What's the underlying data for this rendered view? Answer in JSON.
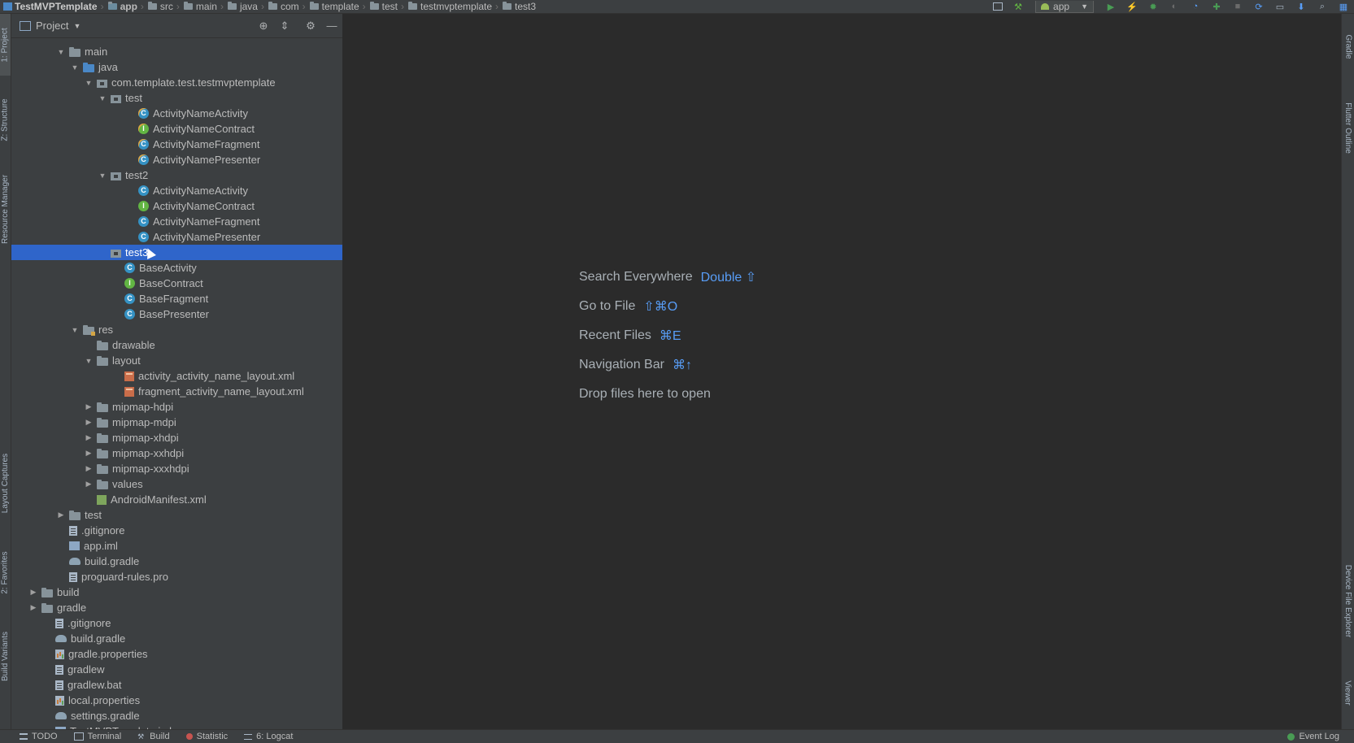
{
  "breadcrumbs": [
    "TestMVPTemplate",
    "app",
    "src",
    "main",
    "java",
    "com",
    "template",
    "test",
    "testmvptemplate",
    "test3"
  ],
  "run_config": {
    "label": "app"
  },
  "project_panel": {
    "title": "Project"
  },
  "tree": [
    {
      "label": "main",
      "indent": 3,
      "arrow": "open",
      "icon": "folder"
    },
    {
      "label": "java",
      "indent": 4,
      "arrow": "open",
      "icon": "folder-src"
    },
    {
      "label": "com.template.test.testmvptemplate",
      "indent": 5,
      "arrow": "open",
      "icon": "package"
    },
    {
      "label": "test",
      "indent": 6,
      "arrow": "open",
      "icon": "package"
    },
    {
      "label": "ActivityNameActivity",
      "indent": 8,
      "arrow": "none",
      "icon": "class-badge",
      "glyph": "C"
    },
    {
      "label": "ActivityNameContract",
      "indent": 8,
      "arrow": "none",
      "icon": "interface-badge",
      "glyph": "I"
    },
    {
      "label": "ActivityNameFragment",
      "indent": 8,
      "arrow": "none",
      "icon": "class-badge",
      "glyph": "C"
    },
    {
      "label": "ActivityNamePresenter",
      "indent": 8,
      "arrow": "none",
      "icon": "class-badge",
      "glyph": "C"
    },
    {
      "label": "test2",
      "indent": 6,
      "arrow": "open",
      "icon": "package"
    },
    {
      "label": "ActivityNameActivity",
      "indent": 8,
      "arrow": "none",
      "icon": "class",
      "glyph": "C"
    },
    {
      "label": "ActivityNameContract",
      "indent": 8,
      "arrow": "none",
      "icon": "interface",
      "glyph": "I"
    },
    {
      "label": "ActivityNameFragment",
      "indent": 8,
      "arrow": "none",
      "icon": "class",
      "glyph": "C"
    },
    {
      "label": "ActivityNamePresenter",
      "indent": 8,
      "arrow": "none",
      "icon": "class",
      "glyph": "C"
    },
    {
      "label": "test3",
      "indent": 6,
      "arrow": "none",
      "icon": "package",
      "selected": true
    },
    {
      "label": "BaseActivity",
      "indent": 7,
      "arrow": "none",
      "icon": "class",
      "glyph": "C"
    },
    {
      "label": "BaseContract",
      "indent": 7,
      "arrow": "none",
      "icon": "interface",
      "glyph": "I"
    },
    {
      "label": "BaseFragment",
      "indent": 7,
      "arrow": "none",
      "icon": "class",
      "glyph": "C"
    },
    {
      "label": "BasePresenter",
      "indent": 7,
      "arrow": "none",
      "icon": "class",
      "glyph": "C"
    },
    {
      "label": "res",
      "indent": 4,
      "arrow": "open",
      "icon": "folder-res"
    },
    {
      "label": "drawable",
      "indent": 5,
      "arrow": "none",
      "icon": "folder"
    },
    {
      "label": "layout",
      "indent": 5,
      "arrow": "open",
      "icon": "folder"
    },
    {
      "label": "activity_activity_name_layout.xml",
      "indent": 7,
      "arrow": "none",
      "icon": "xml"
    },
    {
      "label": "fragment_activity_name_layout.xml",
      "indent": 7,
      "arrow": "none",
      "icon": "xml"
    },
    {
      "label": "mipmap-hdpi",
      "indent": 5,
      "arrow": "closed",
      "icon": "folder"
    },
    {
      "label": "mipmap-mdpi",
      "indent": 5,
      "arrow": "closed",
      "icon": "folder"
    },
    {
      "label": "mipmap-xhdpi",
      "indent": 5,
      "arrow": "closed",
      "icon": "folder"
    },
    {
      "label": "mipmap-xxhdpi",
      "indent": 5,
      "arrow": "closed",
      "icon": "folder"
    },
    {
      "label": "mipmap-xxxhdpi",
      "indent": 5,
      "arrow": "closed",
      "icon": "folder"
    },
    {
      "label": "values",
      "indent": 5,
      "arrow": "closed",
      "icon": "folder"
    },
    {
      "label": "AndroidManifest.xml",
      "indent": 5,
      "arrow": "none",
      "icon": "manifest"
    },
    {
      "label": "test",
      "indent": 3,
      "arrow": "closed",
      "icon": "folder"
    },
    {
      "label": ".gitignore",
      "indent": 3,
      "arrow": "none",
      "icon": "file"
    },
    {
      "label": "app.iml",
      "indent": 3,
      "arrow": "none",
      "icon": "iml"
    },
    {
      "label": "build.gradle",
      "indent": 3,
      "arrow": "none",
      "icon": "gradle"
    },
    {
      "label": "proguard-rules.pro",
      "indent": 3,
      "arrow": "none",
      "icon": "file"
    },
    {
      "label": "build",
      "indent": 1,
      "arrow": "closed",
      "icon": "folder"
    },
    {
      "label": "gradle",
      "indent": 1,
      "arrow": "closed",
      "icon": "folder"
    },
    {
      "label": ".gitignore",
      "indent": 2,
      "arrow": "none",
      "icon": "file"
    },
    {
      "label": "build.gradle",
      "indent": 2,
      "arrow": "none",
      "icon": "gradle"
    },
    {
      "label": "gradle.properties",
      "indent": 2,
      "arrow": "none",
      "icon": "props"
    },
    {
      "label": "gradlew",
      "indent": 2,
      "arrow": "none",
      "icon": "file"
    },
    {
      "label": "gradlew.bat",
      "indent": 2,
      "arrow": "none",
      "icon": "file"
    },
    {
      "label": "local.properties",
      "indent": 2,
      "arrow": "none",
      "icon": "props"
    },
    {
      "label": "settings.gradle",
      "indent": 2,
      "arrow": "none",
      "icon": "gradle"
    },
    {
      "label": "TestMVPTemplate.iml",
      "indent": 2,
      "arrow": "none",
      "icon": "iml"
    }
  ],
  "editor_hints": [
    {
      "text": "Search Everywhere",
      "shortcut": "Double ⇧"
    },
    {
      "text": "Go to File",
      "shortcut": "⇧⌘O"
    },
    {
      "text": "Recent Files",
      "shortcut": "⌘E"
    },
    {
      "text": "Navigation Bar",
      "shortcut": "⌘↑"
    },
    {
      "text": "Drop files here to open",
      "shortcut": ""
    }
  ],
  "left_tabs": [
    "1: Project",
    "Z: Structure",
    "Resource Manager",
    "Layout Captures",
    "2: Favorites",
    "Build Variants"
  ],
  "right_tabs": [
    "Gradle",
    "Flutter Outline",
    "Device File Explorer",
    "Viewer"
  ],
  "bottom_tabs": [
    "TODO",
    "Terminal",
    "Build",
    "Statistic",
    "6: Logcat"
  ],
  "event_log": "Event Log",
  "colors": {
    "selection": "#2f65ca",
    "shortcut": "#589df6",
    "background": "#2b2b2b",
    "panel": "#3c3f41"
  }
}
